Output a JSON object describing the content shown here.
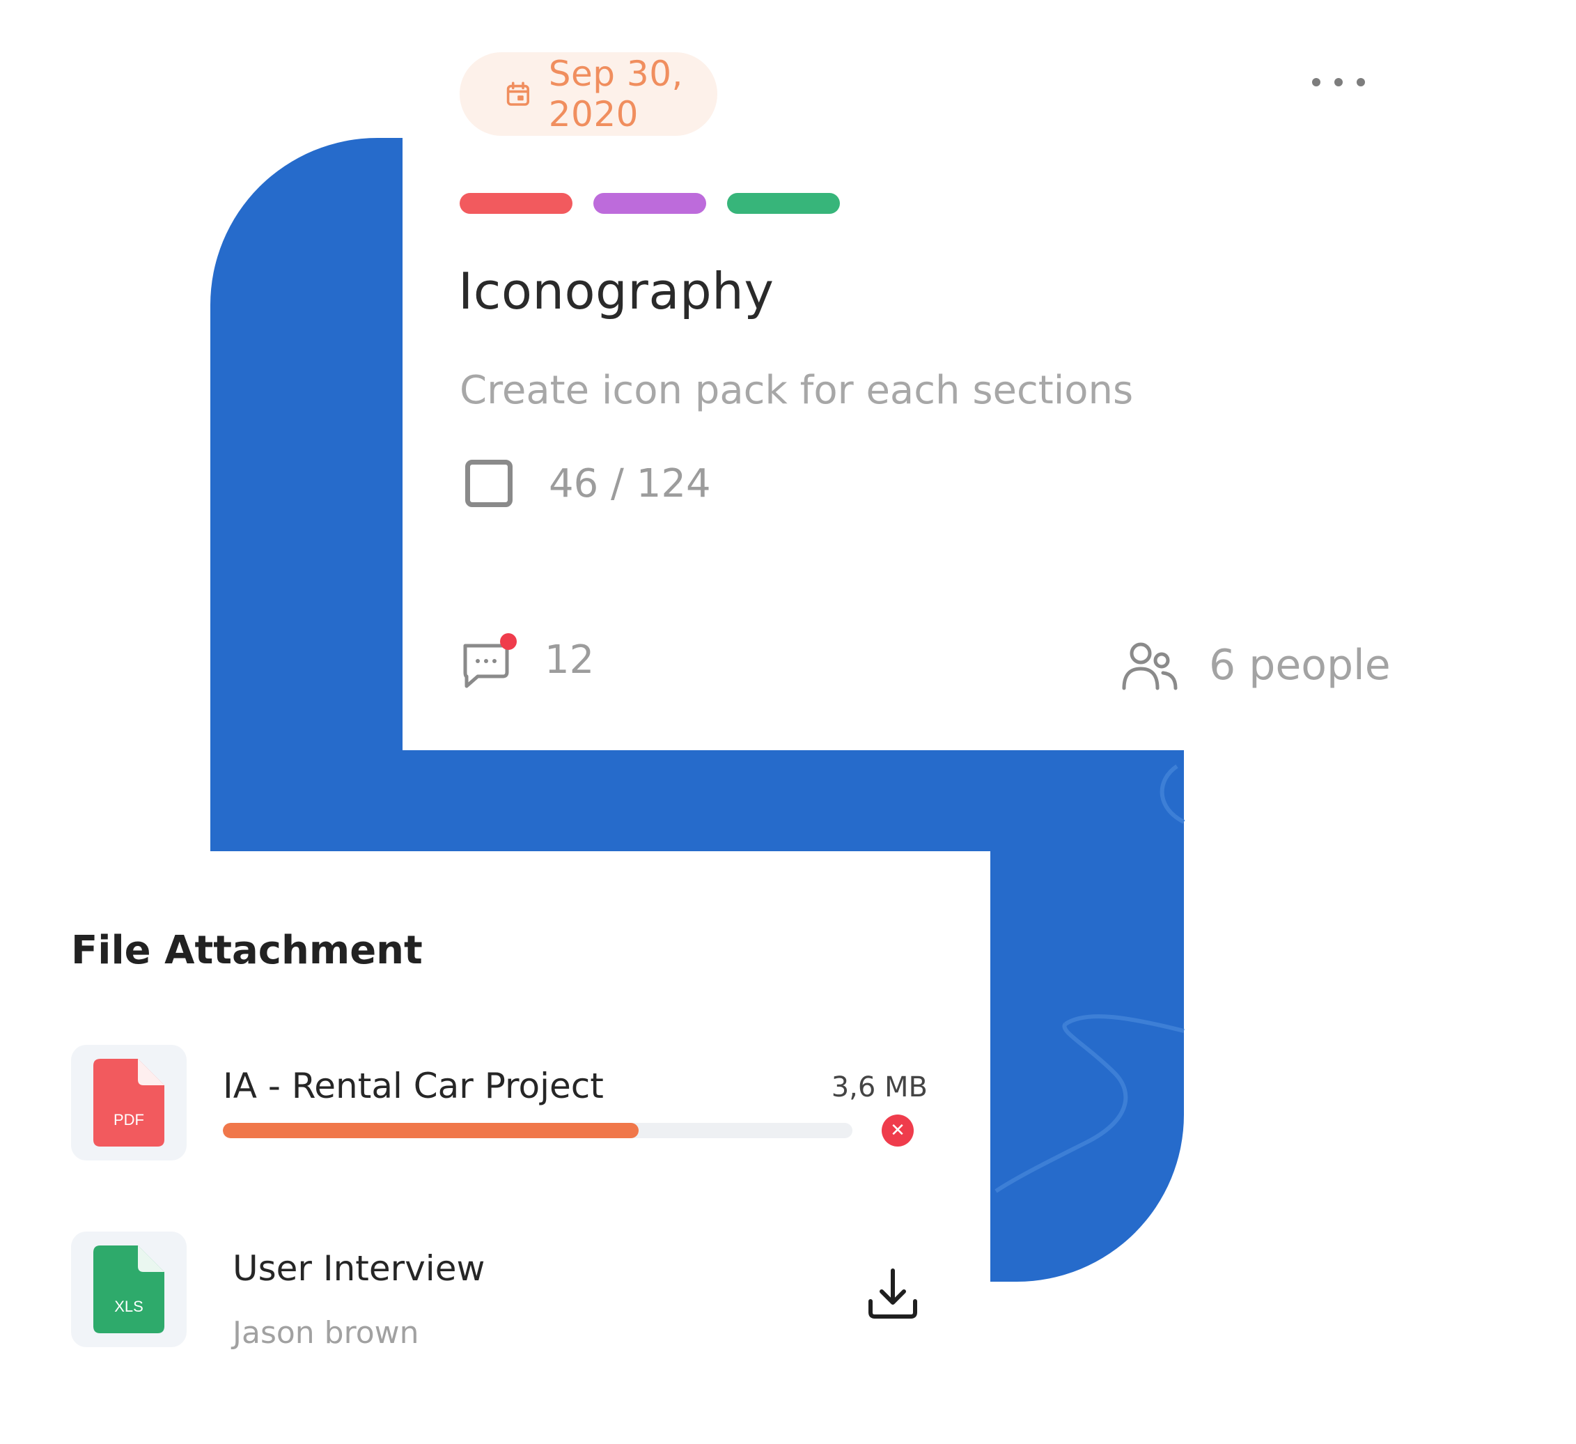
{
  "colors": {
    "brand_blue": "#266BCB",
    "date_accent": "#F08E5E",
    "tag_red": "#F25A5E",
    "tag_purple": "#BD6BDB",
    "tag_green": "#37B57A",
    "notification_dot": "#EF3C4C",
    "progress_fill": "#F0774A",
    "pdf_red": "#F25A5E",
    "xls_green": "#2EAA6B"
  },
  "task_card": {
    "date": "Sep 30, 2020",
    "date_icon": "calendar-icon",
    "more_icon": "more-horizontal-icon",
    "tags": [
      {
        "color": "#F25A5E"
      },
      {
        "color": "#BD6BDB"
      },
      {
        "color": "#37B57A"
      }
    ],
    "title": "Iconography",
    "description": "Create icon pack for each sections",
    "checklist": {
      "icon": "checkbox-icon",
      "count": "46 / 124"
    },
    "comments": {
      "icon": "comment-icon",
      "count": "12",
      "has_unread": true
    },
    "members": {
      "icon": "people-icon",
      "label": "6 people"
    }
  },
  "file_attachment": {
    "heading": "File Attachment",
    "files": [
      {
        "type_label": "PDF",
        "name": "IA - Rental Car Project",
        "size": "3,6 MB",
        "upload_progress": 0.66,
        "action_icon": "close-icon"
      },
      {
        "type_label": "XLS",
        "name": "User Interview",
        "owner": "Jason brown",
        "action_icon": "download-icon"
      }
    ]
  }
}
